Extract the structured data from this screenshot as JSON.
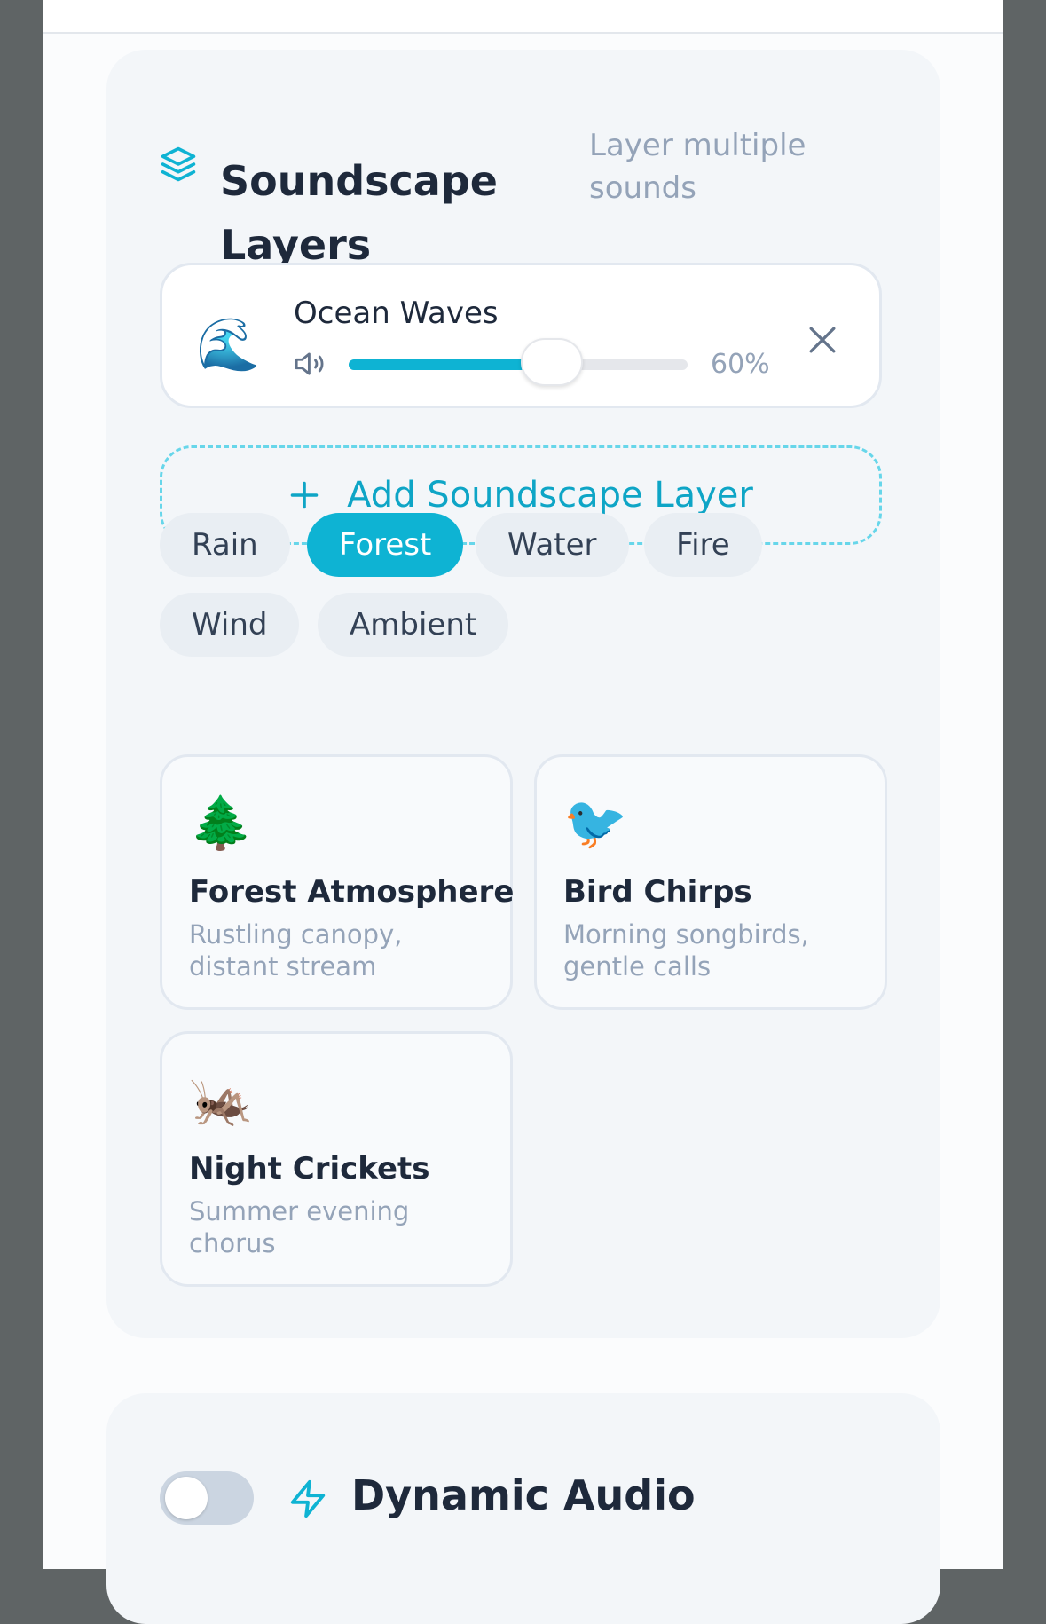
{
  "soundscape": {
    "title": "Soundscape Layers",
    "subtitle": "Layer multiple sounds",
    "icon": "layers-icon",
    "accent_color": "#0eb3d3",
    "active_layers": [
      {
        "emoji": "🌊",
        "name": "Ocean Waves",
        "volume": 0.6,
        "volume_label": "60%"
      }
    ],
    "add_layer_label": "Add Soundscape Layer",
    "categories": [
      "Rain",
      "Forest",
      "Water",
      "Fire",
      "Wind",
      "Ambient"
    ],
    "selected_category": "Forest",
    "sounds": [
      {
        "emoji": "🌲",
        "title": "Forest Atmosphere",
        "description": "Rustling canopy, distant stream"
      },
      {
        "emoji": "🐦",
        "title": "Bird Chirps",
        "description": "Morning songbirds, gentle calls"
      },
      {
        "emoji": "🦗",
        "title": "Night Crickets",
        "description": "Summer evening chorus"
      }
    ]
  },
  "dynamic_audio": {
    "title": "Dynamic Audio",
    "enabled": false,
    "icon": "bolt-icon"
  }
}
